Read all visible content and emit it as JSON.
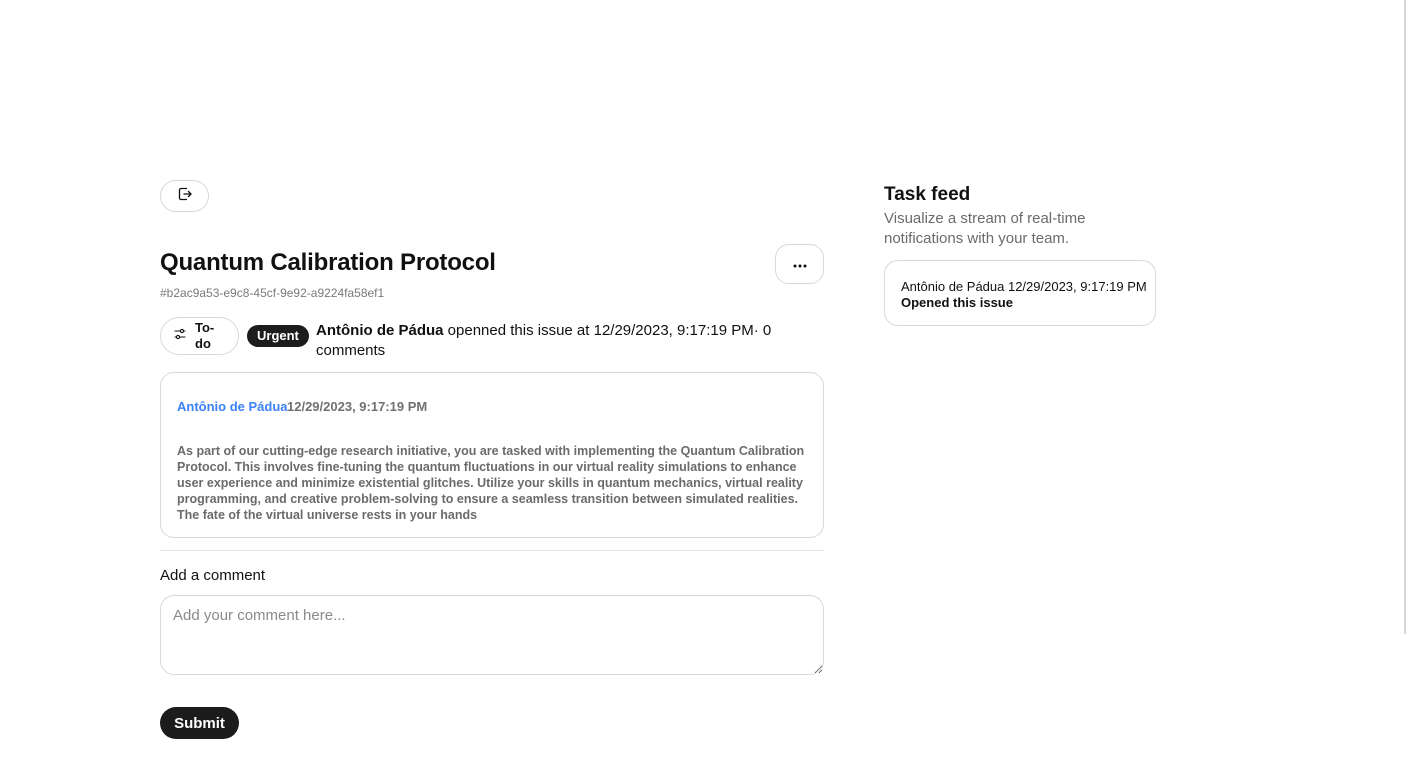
{
  "issue": {
    "title": "Quantum Calibration Protocol",
    "id": "#b2ac9a53-e9c8-45cf-9e92-a9224fa58ef1",
    "status_label": "To-do",
    "priority_badge": "Urgent",
    "author": "Antônio de Pádua",
    "opened_text": " openned this issue at 12/29/2023, 9:17:19 PM· 0 comments",
    "icons": {
      "back": "exit-icon",
      "more": "ellipsis-icon",
      "status": "sliders-icon"
    }
  },
  "comment": {
    "author": "Antônio de Pádua",
    "timestamp": "12/29/2023, 9:17:19 PM",
    "body": "As part of our cutting-edge research initiative, you are tasked with implementing the Quantum Calibration Protocol. This involves fine-tuning the quantum fluctuations in our virtual reality simulations to enhance user experience and minimize existential glitches. Utilize your skills in quantum mechanics, virtual reality programming, and creative problem-solving to ensure a seamless transition between simulated realities. The fate of the virtual universe rests in your hands"
  },
  "add_comment": {
    "label": "Add a comment",
    "placeholder": "Add your comment here...",
    "value": "",
    "submit_label": "Submit"
  },
  "task_feed": {
    "title": "Task feed",
    "description": "Visualize a stream of real-time notifications with your team.",
    "items": [
      {
        "header": "Antônio de Pádua 12/29/2023, 9:17:19 PM",
        "action": "Opened this issue"
      }
    ]
  },
  "colors": {
    "link": "#3b82f6",
    "dark_button": "#1c1c1c",
    "border": "#d9d9d9",
    "muted_text": "#6b6b6b"
  }
}
